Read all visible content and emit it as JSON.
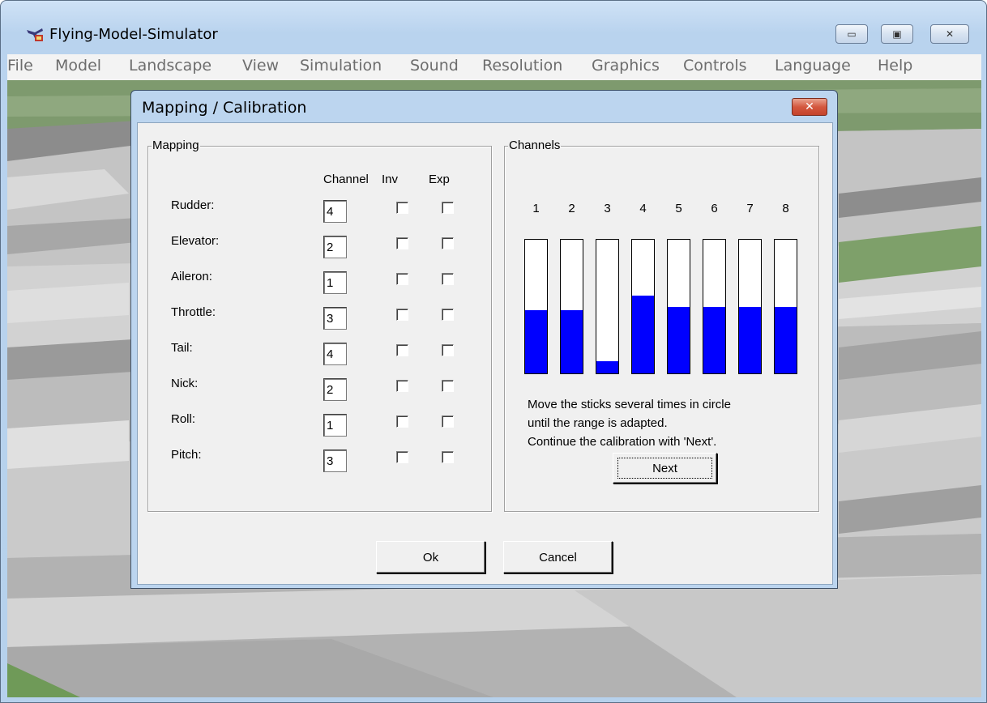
{
  "window": {
    "title": "Flying-Model-Simulator",
    "icon": "airplane-app-icon"
  },
  "menu": [
    "File",
    "Model",
    "Landscape",
    "View",
    "Simulation",
    "Sound",
    "Resolution",
    "Graphics",
    "Controls",
    "Language",
    "Help"
  ],
  "dialog": {
    "title": "Mapping / Calibration",
    "mapping": {
      "group_label": "Mapping",
      "headers": {
        "channel": "Channel",
        "inv": "Inv",
        "exp": "Exp"
      },
      "rows": [
        {
          "label": "Rudder:",
          "channel": "4",
          "inv": false,
          "exp": false
        },
        {
          "label": "Elevator:",
          "channel": "2",
          "inv": false,
          "exp": false
        },
        {
          "label": "Aileron:",
          "channel": "1",
          "inv": false,
          "exp": false
        },
        {
          "label": "Throttle:",
          "channel": "3",
          "inv": false,
          "exp": false
        },
        {
          "label": "Tail:",
          "channel": "4",
          "inv": false,
          "exp": false
        },
        {
          "label": "Nick:",
          "channel": "2",
          "inv": false,
          "exp": false
        },
        {
          "label": "Roll:",
          "channel": "1",
          "inv": false,
          "exp": false
        },
        {
          "label": "Pitch:",
          "channel": "3",
          "inv": false,
          "exp": false
        }
      ]
    },
    "channels": {
      "group_label": "Channels",
      "numbers": [
        "1",
        "2",
        "3",
        "4",
        "5",
        "6",
        "7",
        "8"
      ],
      "levels": [
        0.47,
        0.47,
        0.09,
        0.58,
        0.5,
        0.5,
        0.5,
        0.5
      ],
      "fill_color": "#0000ff",
      "instructions": [
        "Move the sticks several times in circle",
        "until the range is adapted.",
        "Continue the calibration with 'Next'."
      ],
      "next_label": "Next"
    },
    "ok_label": "Ok",
    "cancel_label": "Cancel"
  }
}
